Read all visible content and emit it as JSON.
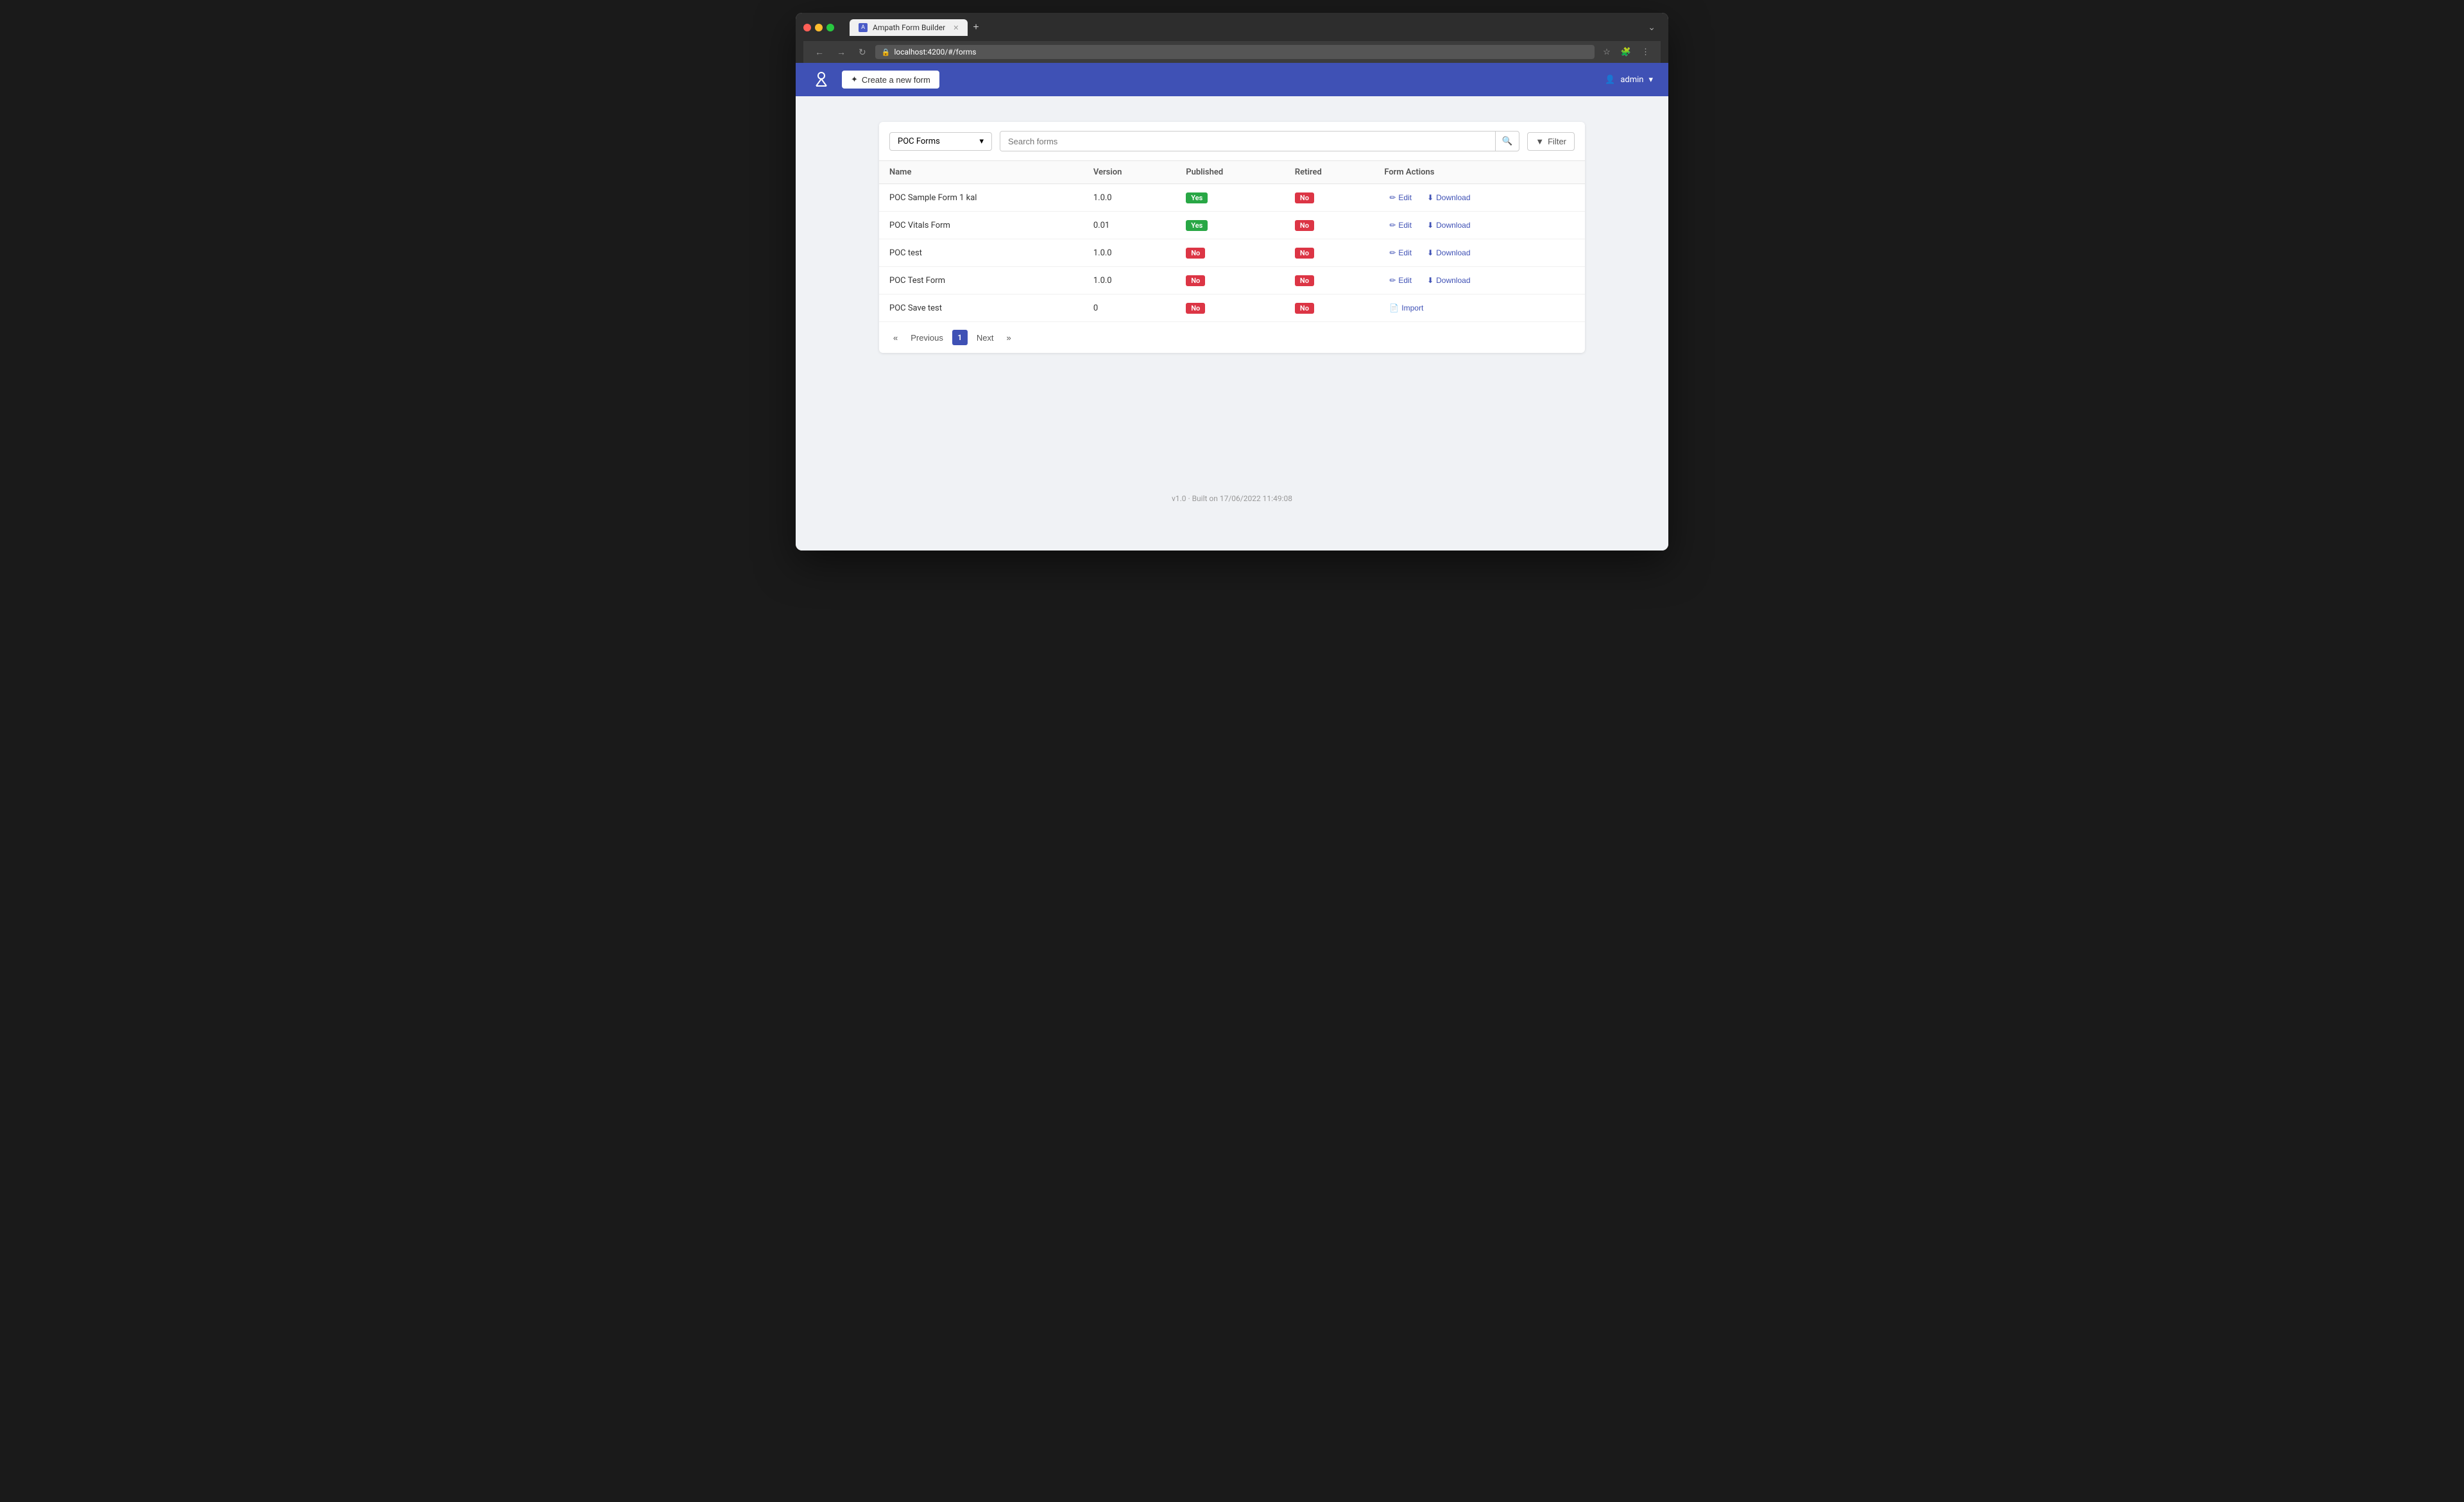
{
  "browser": {
    "tab_title": "Ampath Form Builder",
    "url": "localhost:4200/#/forms",
    "new_tab_symbol": "+"
  },
  "header": {
    "create_btn_label": "Create a new form",
    "create_btn_icon": "+",
    "user_label": "admin",
    "user_icon": "👤"
  },
  "toolbar": {
    "select_value": "POC Forms",
    "select_arrow": "▾",
    "search_placeholder": "Search forms",
    "filter_label": "Filter",
    "filter_icon": "⚡"
  },
  "table": {
    "columns": [
      "Name",
      "Version",
      "Published",
      "Retired",
      "Form Actions"
    ],
    "rows": [
      {
        "name": "POC Sample Form 1 kal",
        "version": "1.0.0",
        "published": "Yes",
        "published_status": "yes",
        "retired": "No",
        "retired_status": "no",
        "actions": [
          "Edit",
          "Download"
        ]
      },
      {
        "name": "POC Vitals Form",
        "version": "0.01",
        "published": "Yes",
        "published_status": "yes",
        "retired": "No",
        "retired_status": "no",
        "actions": [
          "Edit",
          "Download"
        ]
      },
      {
        "name": "POC test",
        "version": "1.0.0",
        "published": "No",
        "published_status": "no",
        "retired": "No",
        "retired_status": "no",
        "actions": [
          "Edit",
          "Download"
        ]
      },
      {
        "name": "POC Test Form",
        "version": "1.0.0",
        "published": "No",
        "published_status": "no",
        "retired": "No",
        "retired_status": "no",
        "actions": [
          "Edit",
          "Download"
        ]
      },
      {
        "name": "POC Save test",
        "version": "0",
        "published": "No",
        "published_status": "no",
        "retired": "No",
        "retired_status": "no",
        "actions": [
          "Import"
        ]
      }
    ]
  },
  "pagination": {
    "previous_label": "Previous",
    "next_label": "Next",
    "current_page": "1",
    "prev_arrow": "«",
    "next_arrow": "»"
  },
  "footer": {
    "version_text": "v1.0 · Built on 17/06/2022 11:49:08"
  },
  "icons": {
    "pencil": "✏",
    "download": "⬇",
    "import": "📄",
    "search": "🔍",
    "filter": "▼"
  }
}
